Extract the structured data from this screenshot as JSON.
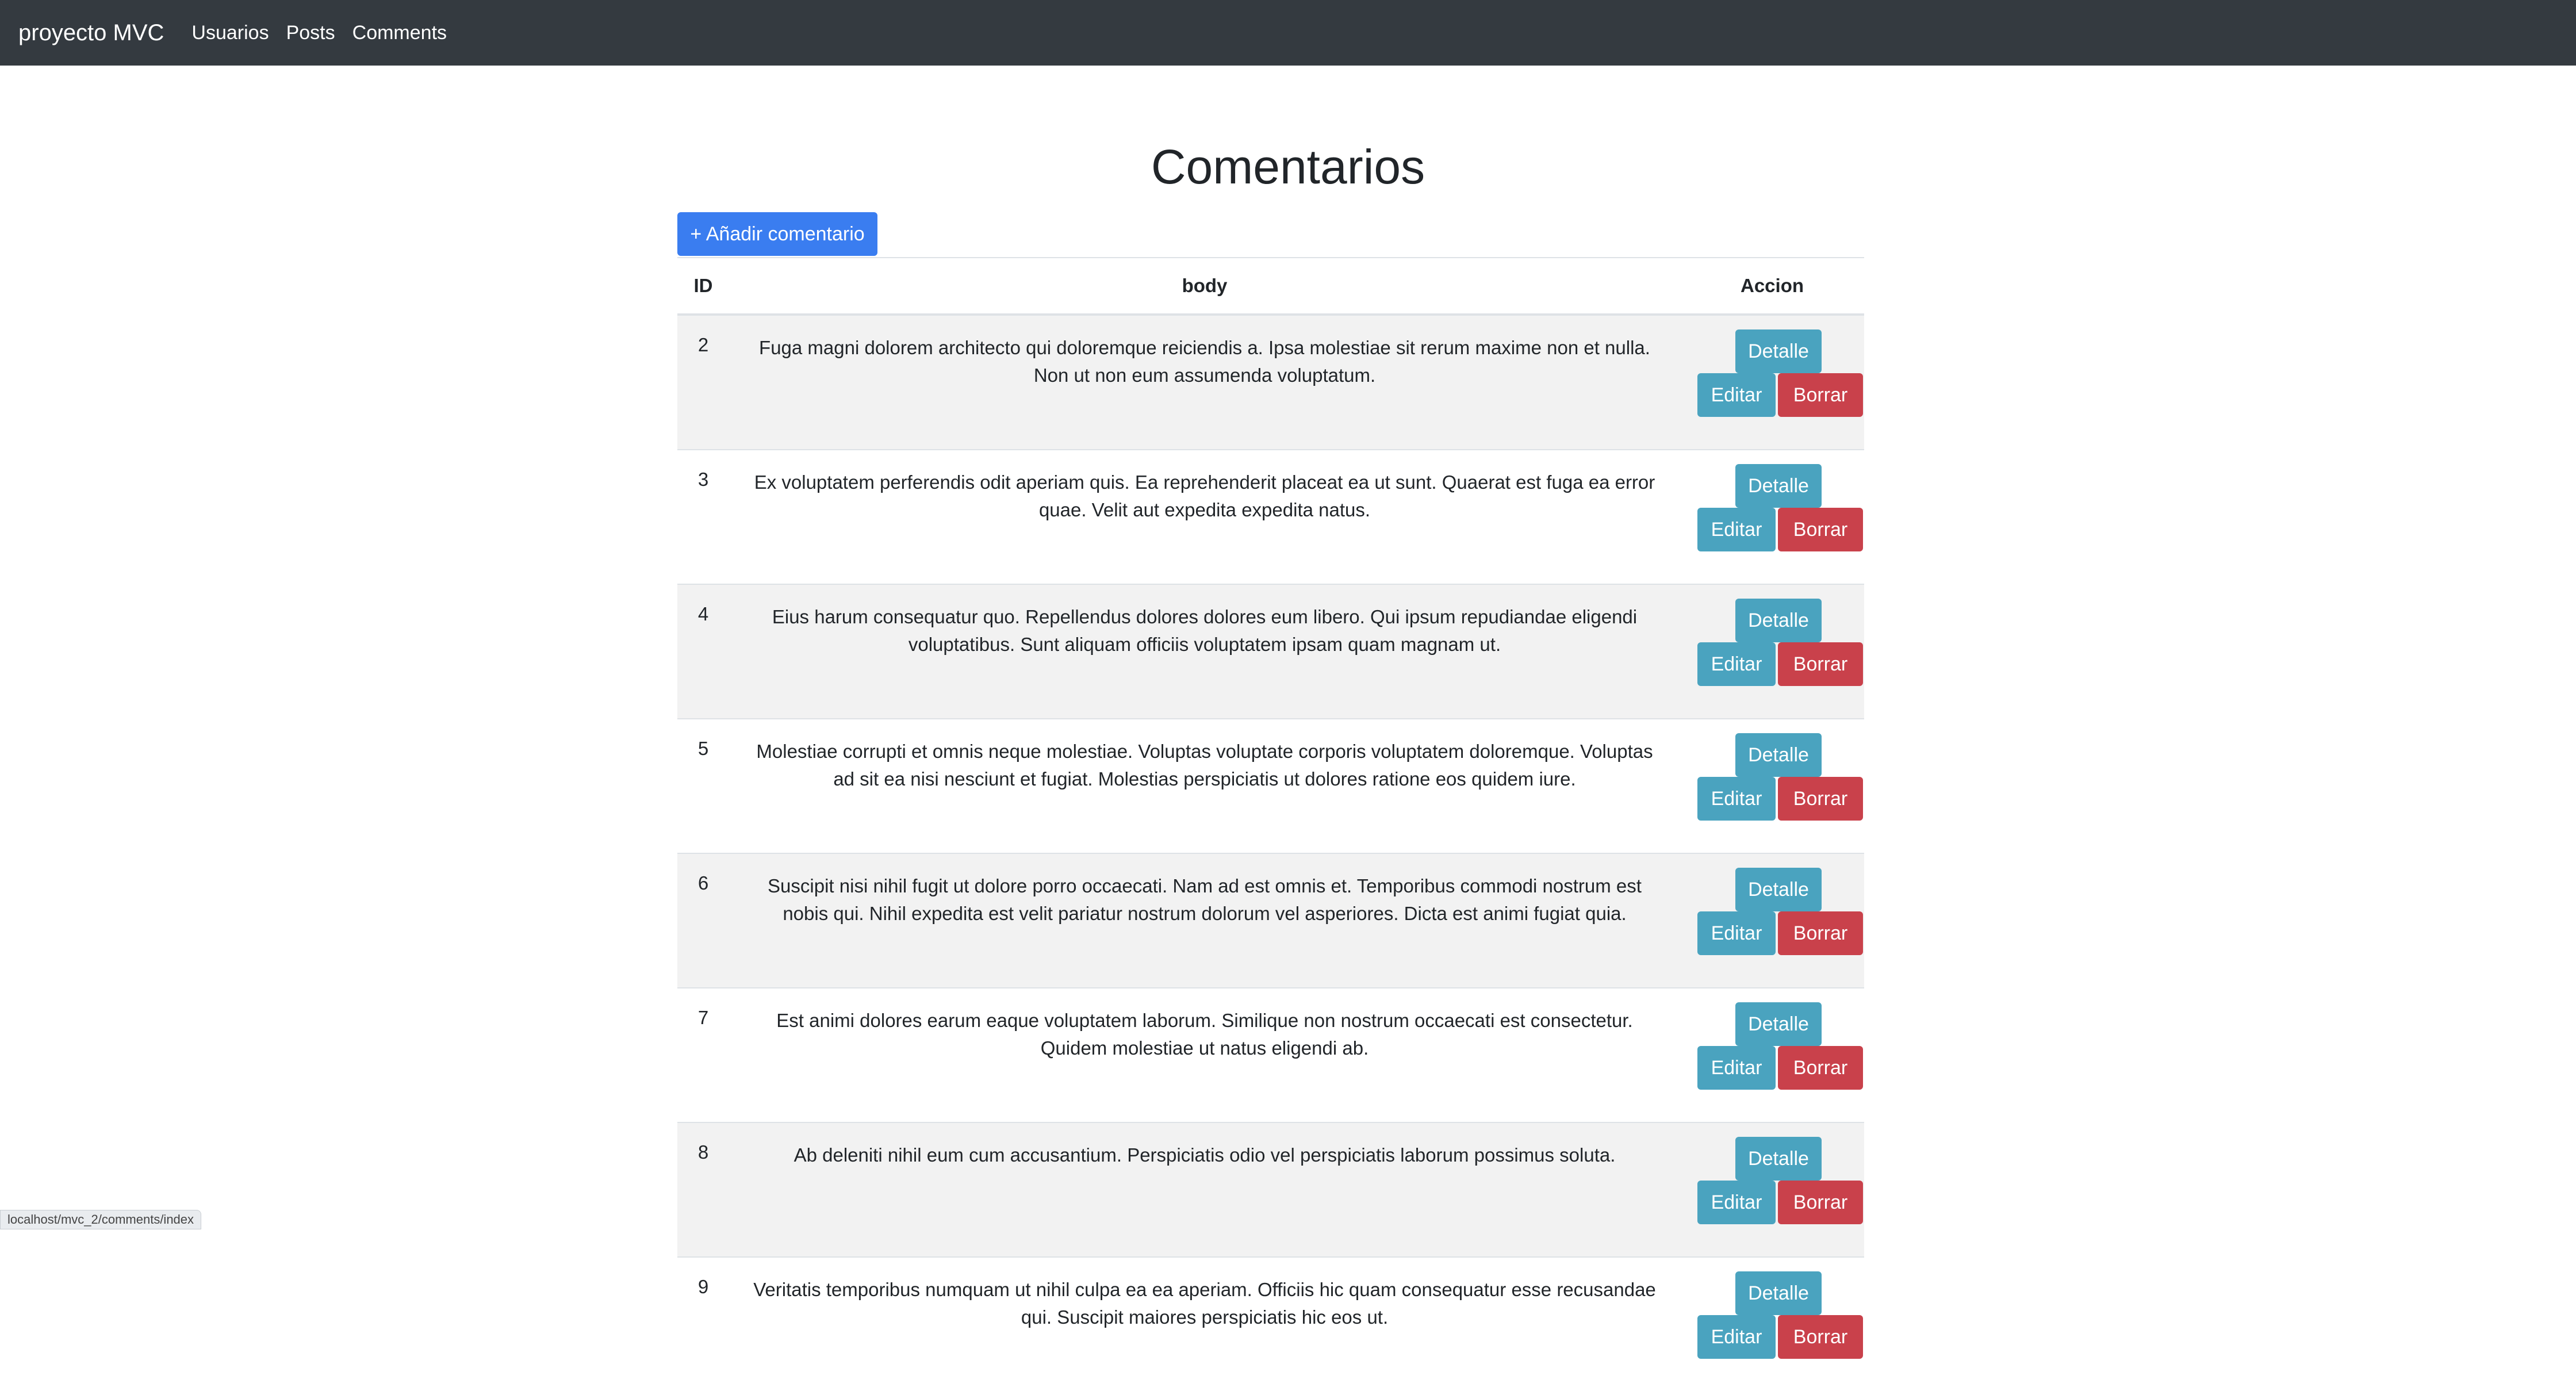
{
  "navbar": {
    "brand": "proyecto MVC",
    "links": [
      "Usuarios",
      "Posts",
      "Comments"
    ]
  },
  "page": {
    "title": "Comentarios",
    "add_button": "+ Añadir comentario"
  },
  "table": {
    "headers": {
      "id": "ID",
      "body": "body",
      "action": "Accion"
    },
    "action_labels": {
      "detail": "Detalle",
      "edit": "Editar",
      "delete": "Borrar"
    },
    "rows": [
      {
        "id": "2",
        "body": "Fuga magni dolorem architecto qui doloremque reiciendis a. Ipsa molestiae sit rerum maxime non et nulla. Non ut non eum assumenda voluptatum."
      },
      {
        "id": "3",
        "body": "Ex voluptatem perferendis odit aperiam quis. Ea reprehenderit placeat ea ut sunt. Quaerat est fuga ea error quae. Velit aut expedita expedita natus."
      },
      {
        "id": "4",
        "body": "Eius harum consequatur quo. Repellendus dolores dolores eum libero. Qui ipsum repudiandae eligendi voluptatibus. Sunt aliquam officiis voluptatem ipsam quam magnam ut."
      },
      {
        "id": "5",
        "body": "Molestiae corrupti et omnis neque molestiae. Voluptas voluptate corporis voluptatem doloremque. Voluptas ad sit ea nisi nesciunt et fugiat. Molestias perspiciatis ut dolores ratione eos quidem iure."
      },
      {
        "id": "6",
        "body": "Suscipit nisi nihil fugit ut dolore porro occaecati. Nam ad est omnis et. Temporibus commodi nostrum est nobis qui. Nihil expedita est velit pariatur nostrum dolorum vel asperiores. Dicta est animi fugiat quia."
      },
      {
        "id": "7",
        "body": "Est animi dolores earum eaque voluptatem laborum. Similique non nostrum occaecati est consectetur. Quidem molestiae ut natus eligendi ab."
      },
      {
        "id": "8",
        "body": "Ab deleniti nihil eum cum accusantium. Perspiciatis odio vel perspiciatis laborum possimus soluta."
      },
      {
        "id": "9",
        "body": "Veritatis temporibus numquam ut nihil culpa ea ea aperiam. Officiis hic quam consequatur esse recusandae qui. Suscipit maiores perspiciatis hic eos ut."
      }
    ]
  },
  "status_bar": {
    "url": "localhost/mvc_2/comments/index"
  },
  "colors": {
    "navbar": "#343a40",
    "primary": "#3a7df0",
    "info": "#4aa3bf",
    "danger": "#c9414b"
  }
}
